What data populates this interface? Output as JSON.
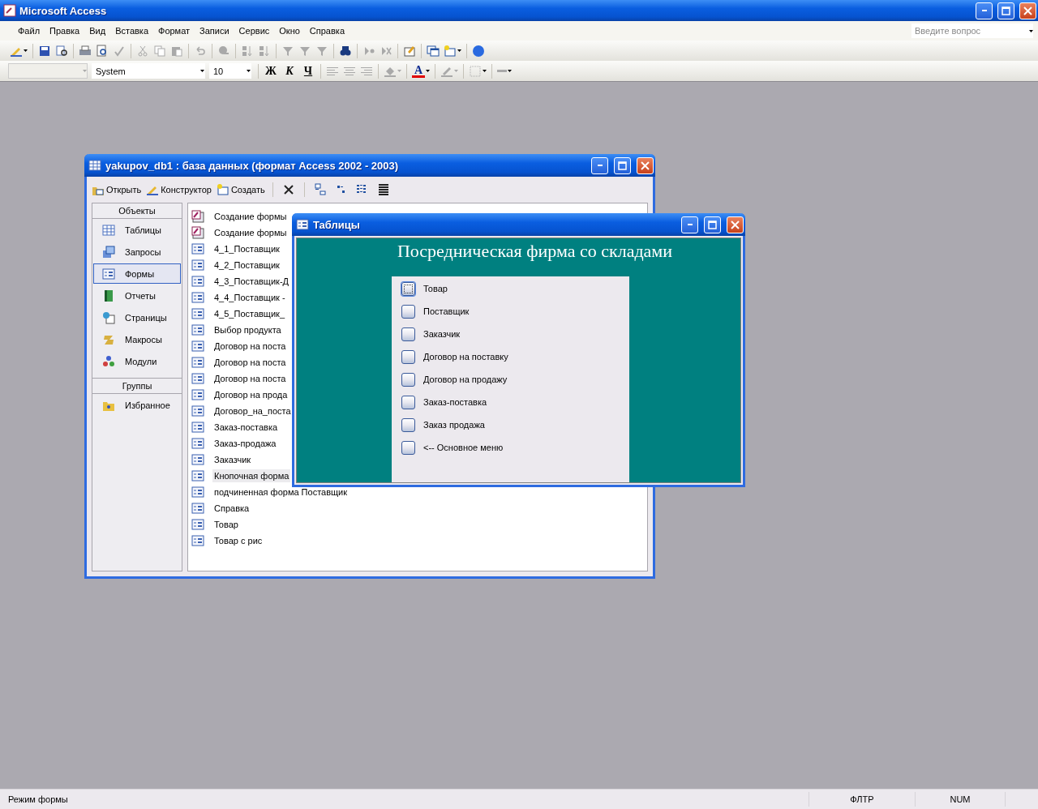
{
  "app": {
    "title": "Microsoft Access"
  },
  "menu": [
    "Файл",
    "Правка",
    "Вид",
    "Вставка",
    "Формат",
    "Записи",
    "Сервис",
    "Окно",
    "Справка"
  ],
  "ask_box": {
    "placeholder": "Введите вопрос"
  },
  "toolbar": [
    {
      "kind": "design",
      "dropdown": true,
      "disabled": false
    },
    {
      "kind": "sep"
    },
    {
      "kind": "save",
      "dropdown": false,
      "disabled": false
    },
    {
      "kind": "search",
      "dropdown": false,
      "disabled": false
    },
    {
      "kind": "sep"
    },
    {
      "kind": "print",
      "dropdown": false,
      "disabled": false
    },
    {
      "kind": "preview",
      "dropdown": false,
      "disabled": false
    },
    {
      "kind": "spell",
      "dropdown": false,
      "disabled": true
    },
    {
      "kind": "sep"
    },
    {
      "kind": "cut",
      "dropdown": false,
      "disabled": true
    },
    {
      "kind": "copy",
      "dropdown": false,
      "disabled": true
    },
    {
      "kind": "paste",
      "dropdown": false,
      "disabled": true
    },
    {
      "kind": "sep"
    },
    {
      "kind": "undo",
      "dropdown": false,
      "disabled": true
    },
    {
      "kind": "sep"
    },
    {
      "kind": "link",
      "dropdown": false,
      "disabled": true
    },
    {
      "kind": "sep"
    },
    {
      "kind": "sort",
      "dropdown": false,
      "disabled": true
    },
    {
      "kind": "sort",
      "dropdown": false,
      "disabled": true
    },
    {
      "kind": "sep"
    },
    {
      "kind": "filter",
      "dropdown": false,
      "disabled": true
    },
    {
      "kind": "filter",
      "dropdown": false,
      "disabled": true
    },
    {
      "kind": "filter",
      "dropdown": false,
      "disabled": true
    },
    {
      "kind": "sep"
    },
    {
      "kind": "find",
      "dropdown": false,
      "disabled": false
    },
    {
      "kind": "sep"
    },
    {
      "kind": "record",
      "dropdown": false,
      "disabled": true
    },
    {
      "kind": "delete",
      "dropdown": false,
      "disabled": true
    },
    {
      "kind": "sep"
    },
    {
      "kind": "properties",
      "dropdown": false,
      "disabled": false
    },
    {
      "kind": "sep"
    },
    {
      "kind": "window",
      "dropdown": false,
      "disabled": false
    },
    {
      "kind": "new",
      "dropdown": true,
      "disabled": false
    },
    {
      "kind": "sep"
    },
    {
      "kind": "help",
      "dropdown": false,
      "disabled": false
    }
  ],
  "format_bar": {
    "object_combo": {
      "disabled": true
    },
    "font": "System",
    "size": "10",
    "styles": [
      {
        "label": "Ж",
        "kind": "bold"
      },
      {
        "label": "К",
        "kind": "italic"
      },
      {
        "label": "Ч",
        "kind": "underline"
      }
    ],
    "align": [
      {
        "kind": "left",
        "disabled": true
      },
      {
        "kind": "center",
        "disabled": true
      },
      {
        "kind": "right",
        "disabled": true
      }
    ],
    "fill_color": {
      "disabled": true
    },
    "font_color": {
      "label": "A",
      "disabled": false
    },
    "line_color": {
      "disabled": true
    }
  },
  "db_window": {
    "title": "yakupov_db1 : база данных (формат Access 2002 - 2003)",
    "actions": [
      {
        "label": "Открыть",
        "kind": "open"
      },
      {
        "label": "Конструктор",
        "kind": "design"
      },
      {
        "label": "Создать",
        "kind": "new"
      }
    ],
    "view_tools": [
      {
        "kind": "delete"
      },
      {
        "kind": "large"
      },
      {
        "kind": "small"
      },
      {
        "kind": "list"
      },
      {
        "kind": "details"
      }
    ],
    "objects_header": "Объекты",
    "objects": [
      {
        "label": "Таблицы",
        "kind": "table",
        "selected": false
      },
      {
        "label": "Запросы",
        "kind": "query",
        "selected": false
      },
      {
        "label": "Формы",
        "kind": "form",
        "selected": true
      },
      {
        "label": "Отчеты",
        "kind": "report",
        "selected": false
      },
      {
        "label": "Страницы",
        "kind": "page",
        "selected": false
      },
      {
        "label": "Макросы",
        "kind": "macro",
        "selected": false
      },
      {
        "label": "Модули",
        "kind": "module",
        "selected": false
      }
    ],
    "groups_header": "Группы",
    "groups": [
      {
        "label": "Избранное",
        "kind": "favorites",
        "selected": false
      }
    ],
    "items": [
      {
        "label": "Создание формы",
        "kind": "wizard",
        "selected": false
      },
      {
        "label": "Создание формы",
        "kind": "wizard",
        "selected": false
      },
      {
        "label": "4_1_Поставщик",
        "kind": "form",
        "selected": false
      },
      {
        "label": "4_2_Поставщик",
        "kind": "form",
        "selected": false
      },
      {
        "label": "4_3_Поставщик-Д",
        "kind": "form",
        "selected": false
      },
      {
        "label": "4_4_Поставщик -",
        "kind": "form",
        "selected": false
      },
      {
        "label": "4_5_Поставщик_",
        "kind": "form",
        "selected": false
      },
      {
        "label": "Выбор продукта",
        "kind": "form",
        "selected": false
      },
      {
        "label": "Договор на поста",
        "kind": "form",
        "selected": false
      },
      {
        "label": "Договор на поста",
        "kind": "form",
        "selected": false
      },
      {
        "label": "Договор на поста",
        "kind": "form",
        "selected": false
      },
      {
        "label": "Договор на прода",
        "kind": "form",
        "selected": false
      },
      {
        "label": "Договор_на_поста",
        "kind": "form",
        "selected": false
      },
      {
        "label": "Заказ-поставка",
        "kind": "form",
        "selected": false
      },
      {
        "label": "Заказ-продажа",
        "kind": "form",
        "selected": false
      },
      {
        "label": "Заказчик",
        "kind": "form",
        "selected": false
      },
      {
        "label": "Кнопочная форма",
        "kind": "form",
        "selected": true
      },
      {
        "label": "подчиненная форма Поставщик",
        "kind": "form",
        "selected": false
      },
      {
        "label": "Справка",
        "kind": "form",
        "selected": false
      },
      {
        "label": "Товар",
        "kind": "form",
        "selected": false
      },
      {
        "label": "Товар с рис",
        "kind": "form",
        "selected": false
      }
    ]
  },
  "form_window": {
    "title": "Таблицы",
    "heading": "Посредническая фирма со складами",
    "buttons": [
      {
        "label": "Товар",
        "focused": true
      },
      {
        "label": "Поставщик",
        "focused": false
      },
      {
        "label": "Заказчик",
        "focused": false
      },
      {
        "label": "Договор на поставку",
        "focused": false
      },
      {
        "label": "Договор на продажу",
        "focused": false
      },
      {
        "label": "Заказ-поставка",
        "focused": false
      },
      {
        "label": "Заказ продажа",
        "focused": false
      },
      {
        "label": "<-- Основное меню",
        "focused": false
      }
    ]
  },
  "status_bar": {
    "mode": "Режим формы",
    "indicators": [
      "ФЛТР",
      "NUM"
    ]
  }
}
